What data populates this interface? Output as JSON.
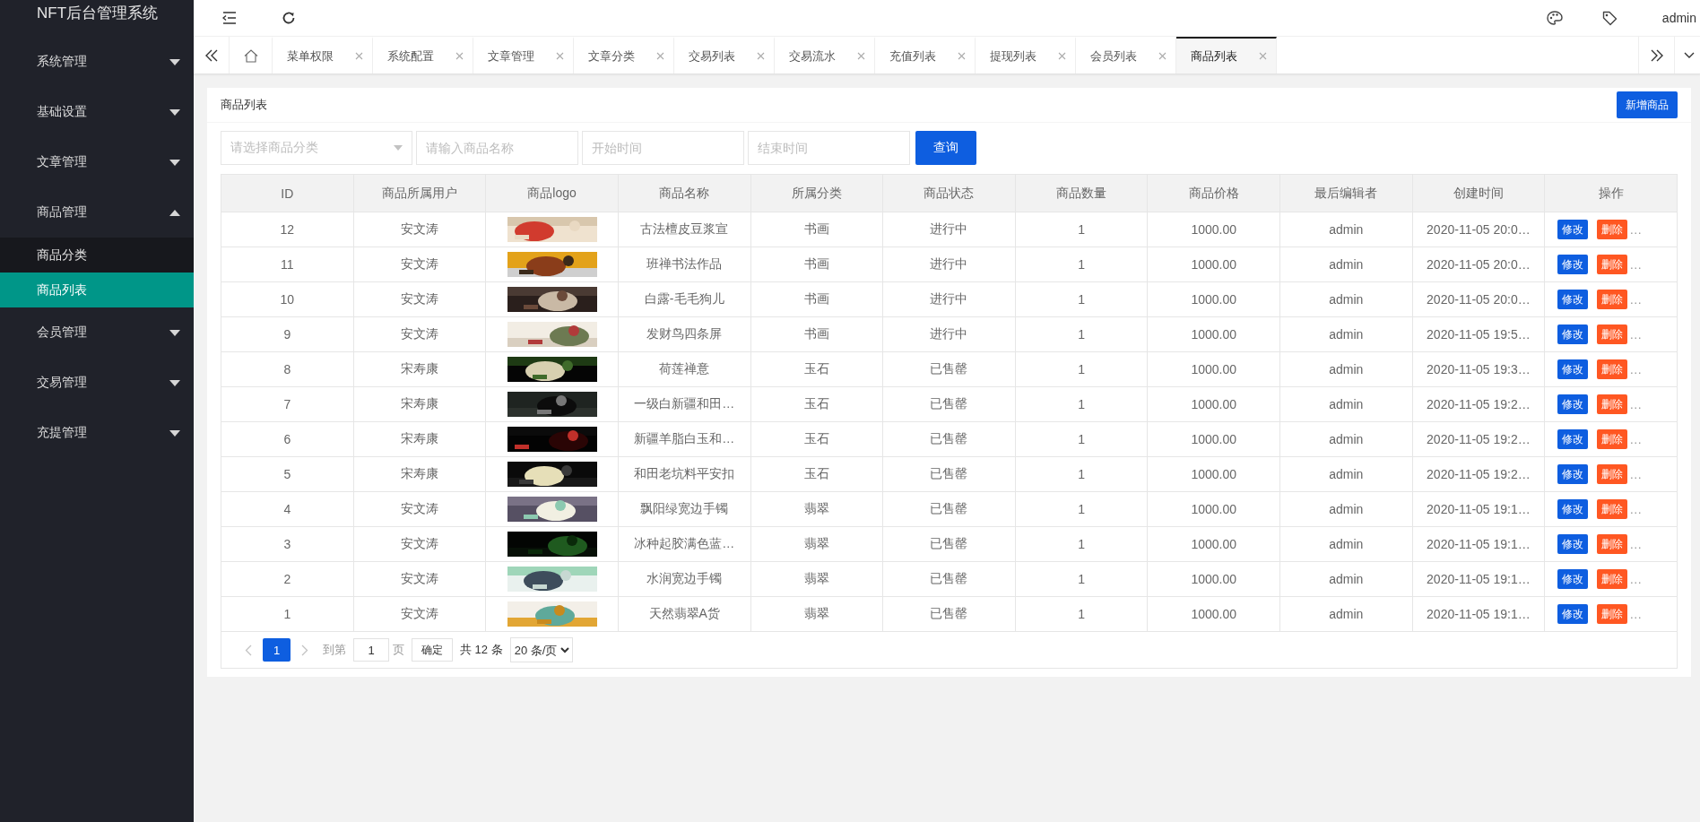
{
  "sidebar": {
    "title": "NFT后台管理系统",
    "items": [
      {
        "label": "系统管理",
        "expanded": false
      },
      {
        "label": "基础设置",
        "expanded": false
      },
      {
        "label": "文章管理",
        "expanded": false
      },
      {
        "label": "商品管理",
        "expanded": true,
        "children": [
          {
            "label": "商品分类",
            "selected": false
          },
          {
            "label": "商品列表",
            "selected": true
          }
        ]
      },
      {
        "label": "会员管理",
        "expanded": false
      },
      {
        "label": "交易管理",
        "expanded": false
      },
      {
        "label": "充提管理",
        "expanded": false
      }
    ]
  },
  "header": {
    "user": "admin"
  },
  "tabs": [
    {
      "label": "菜单权限",
      "selected": false
    },
    {
      "label": "系统配置",
      "selected": false
    },
    {
      "label": "文章管理",
      "selected": false
    },
    {
      "label": "文章分类",
      "selected": false
    },
    {
      "label": "交易列表",
      "selected": false
    },
    {
      "label": "交易流水",
      "selected": false
    },
    {
      "label": "充值列表",
      "selected": false
    },
    {
      "label": "提现列表",
      "selected": false
    },
    {
      "label": "会员列表",
      "selected": false
    },
    {
      "label": "商品列表",
      "selected": true
    }
  ],
  "panel": {
    "title": "商品列表",
    "add_button": "新增商品",
    "filters": {
      "category": {
        "placeholder": "请选择商品分类"
      },
      "name": {
        "placeholder": "请输入商品名称"
      },
      "start": {
        "placeholder": "开始时间"
      },
      "end": {
        "placeholder": "结束时间"
      },
      "search_button": "查询"
    }
  },
  "table": {
    "columns": [
      "ID",
      "商品所属用户",
      "商品logo",
      "商品名称",
      "所属分类",
      "商品状态",
      "商品数量",
      "商品价格",
      "最后编辑者",
      "创建时间",
      "操作"
    ],
    "rows": [
      {
        "id": "12",
        "user": "安文涛",
        "name": "古法檀皮豆浆宣",
        "category": "书画",
        "status": "进行中",
        "quantity": "1",
        "price": "1000.00",
        "editor": "admin",
        "created": "2020-11-05 20:0…",
        "edit": "修改",
        "delete": "删除",
        "more": "…"
      },
      {
        "id": "11",
        "user": "安文涛",
        "name": "班禅书法作品",
        "category": "书画",
        "status": "进行中",
        "quantity": "1",
        "price": "1000.00",
        "editor": "admin",
        "created": "2020-11-05 20:0…",
        "edit": "修改",
        "delete": "删除",
        "more": "…"
      },
      {
        "id": "10",
        "user": "安文涛",
        "name": "白露-毛毛狗儿",
        "category": "书画",
        "status": "进行中",
        "quantity": "1",
        "price": "1000.00",
        "editor": "admin",
        "created": "2020-11-05 20:0…",
        "edit": "修改",
        "delete": "删除",
        "more": "…"
      },
      {
        "id": "9",
        "user": "安文涛",
        "name": "发财鸟四条屏",
        "category": "书画",
        "status": "进行中",
        "quantity": "1",
        "price": "1000.00",
        "editor": "admin",
        "created": "2020-11-05 19:5…",
        "edit": "修改",
        "delete": "删除",
        "more": "…"
      },
      {
        "id": "8",
        "user": "宋寿康",
        "name": "荷莲禅意",
        "category": "玉石",
        "status": "已售罄",
        "quantity": "1",
        "price": "1000.00",
        "editor": "admin",
        "created": "2020-11-05 19:3…",
        "edit": "修改",
        "delete": "删除",
        "more": "…"
      },
      {
        "id": "7",
        "user": "宋寿康",
        "name": "一级白新疆和田…",
        "category": "玉石",
        "status": "已售罄",
        "quantity": "1",
        "price": "1000.00",
        "editor": "admin",
        "created": "2020-11-05 19:2…",
        "edit": "修改",
        "delete": "删除",
        "more": "…"
      },
      {
        "id": "6",
        "user": "宋寿康",
        "name": "新疆羊脂白玉和…",
        "category": "玉石",
        "status": "已售罄",
        "quantity": "1",
        "price": "1000.00",
        "editor": "admin",
        "created": "2020-11-05 19:2…",
        "edit": "修改",
        "delete": "删除",
        "more": "…"
      },
      {
        "id": "5",
        "user": "宋寿康",
        "name": "和田老坑料平安扣",
        "category": "玉石",
        "status": "已售罄",
        "quantity": "1",
        "price": "1000.00",
        "editor": "admin",
        "created": "2020-11-05 19:2…",
        "edit": "修改",
        "delete": "删除",
        "more": "…"
      },
      {
        "id": "4",
        "user": "安文涛",
        "name": "飘阳绿宽边手镯",
        "category": "翡翠",
        "status": "已售罄",
        "quantity": "1",
        "price": "1000.00",
        "editor": "admin",
        "created": "2020-11-05 19:1…",
        "edit": "修改",
        "delete": "删除",
        "more": "…"
      },
      {
        "id": "3",
        "user": "安文涛",
        "name": "冰种起胶满色蓝…",
        "category": "翡翠",
        "status": "已售罄",
        "quantity": "1",
        "price": "1000.00",
        "editor": "admin",
        "created": "2020-11-05 19:1…",
        "edit": "修改",
        "delete": "删除",
        "more": "…"
      },
      {
        "id": "2",
        "user": "安文涛",
        "name": "水润宽边手镯",
        "category": "翡翠",
        "status": "已售罄",
        "quantity": "1",
        "price": "1000.00",
        "editor": "admin",
        "created": "2020-11-05 19:1…",
        "edit": "修改",
        "delete": "删除",
        "more": "…"
      },
      {
        "id": "1",
        "user": "安文涛",
        "name": "天然翡翠A货",
        "category": "翡翠",
        "status": "已售罄",
        "quantity": "1",
        "price": "1000.00",
        "editor": "admin",
        "created": "2020-11-05 19:1…",
        "edit": "修改",
        "delete": "删除",
        "more": "…"
      }
    ]
  },
  "pagination": {
    "pages": [
      {
        "label": "1",
        "selected": true
      }
    ],
    "goto_label": "到第",
    "goto_value": "1",
    "page_unit": "页",
    "confirm": "确定",
    "total": "共 12 条",
    "page_size": "20 条/页"
  }
}
